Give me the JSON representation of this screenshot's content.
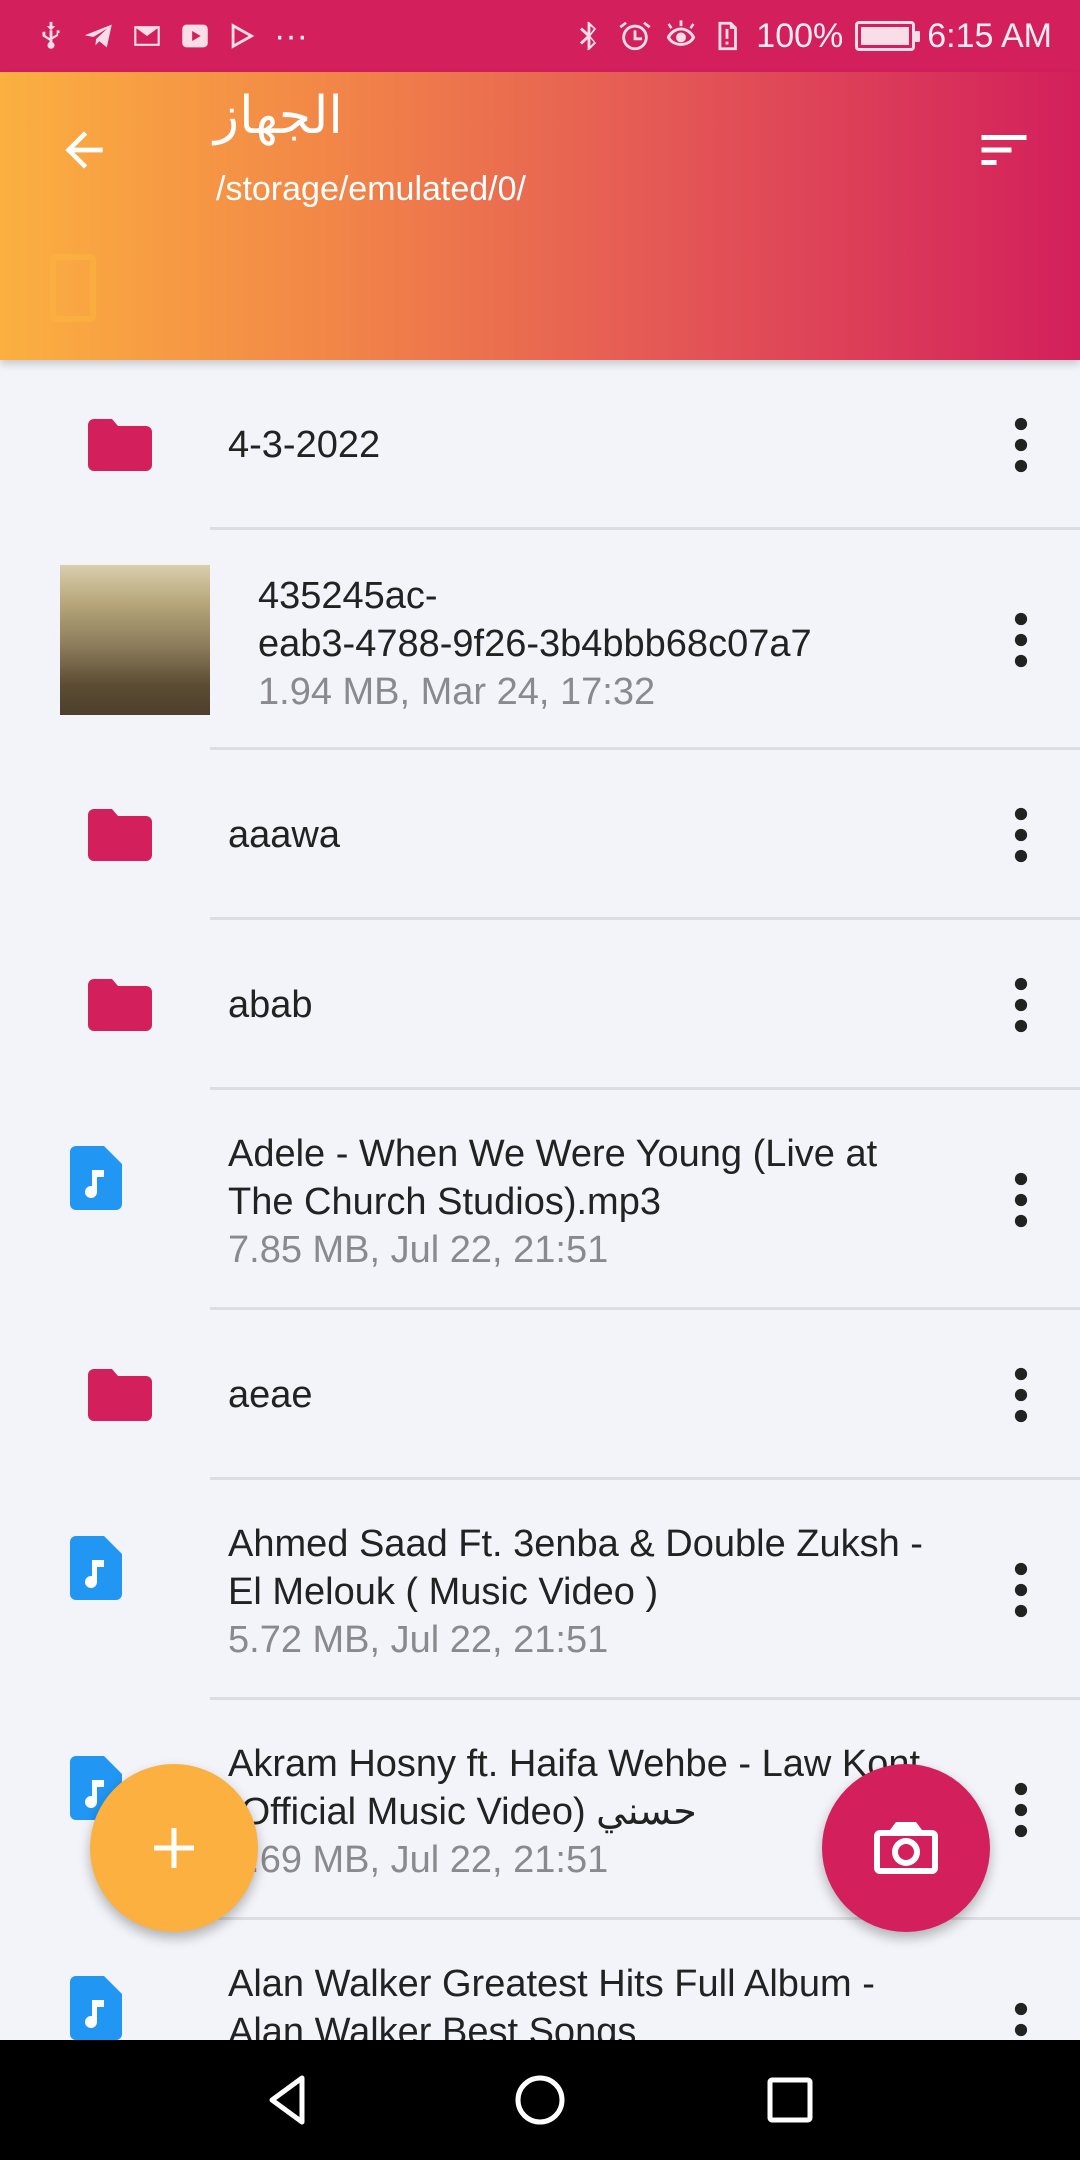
{
  "status_bar": {
    "battery": "100%",
    "time": "6:15 AM",
    "left_icons": [
      "usb-icon",
      "telegram-icon",
      "gmail-icon",
      "youtube-icon",
      "play-store-icon",
      "more-notifications-icon"
    ],
    "more_glyph": "···",
    "right_icons": [
      "bluetooth-icon",
      "alarm-icon",
      "eye-comfort-icon",
      "storage-alert-icon",
      "battery-icon"
    ]
  },
  "header": {
    "title": "الجهاز",
    "path": "/storage/emulated/0/",
    "colors": {
      "gradient_start": "#fbb040",
      "gradient_end": "#d31f5c"
    }
  },
  "files": [
    {
      "type": "folder",
      "name": "4-3-2022",
      "meta": ""
    },
    {
      "type": "image",
      "name": "435245ac-\neab3-4788-9f26-3b4bbb68c07a7",
      "meta": "1.94 MB, Mar 24, 17:32"
    },
    {
      "type": "folder",
      "name": "aaawa",
      "meta": ""
    },
    {
      "type": "folder",
      "name": "abab",
      "meta": ""
    },
    {
      "type": "audio",
      "name": "Adele - When We Were Young (Live at The Church Studios).mp3",
      "meta": "7.85 MB, Jul 22, 21:51"
    },
    {
      "type": "folder",
      "name": "aeae",
      "meta": ""
    },
    {
      "type": "audio",
      "name": "Ahmed Saad Ft. 3enba & Double Zuksh - El Melouk ( Music Video )",
      "meta": "5.72 MB, Jul 22, 21:51"
    },
    {
      "type": "audio",
      "name": "Akram Hosny ft. Haifa Wehbe - Law Kont (Official Music Video) حسني",
      "meta": "5.69 MB, Jul 22, 21:51"
    },
    {
      "type": "audio",
      "name": "Alan Walker Greatest Hits Full Album - Alan Walker Best Songs",
      "meta": ""
    }
  ],
  "fab": {
    "add": "add-icon",
    "camera": "camera-icon"
  },
  "colors": {
    "accent": "#d31f5c",
    "secondary": "#fbb040",
    "audio_icon": "#2196f3"
  }
}
